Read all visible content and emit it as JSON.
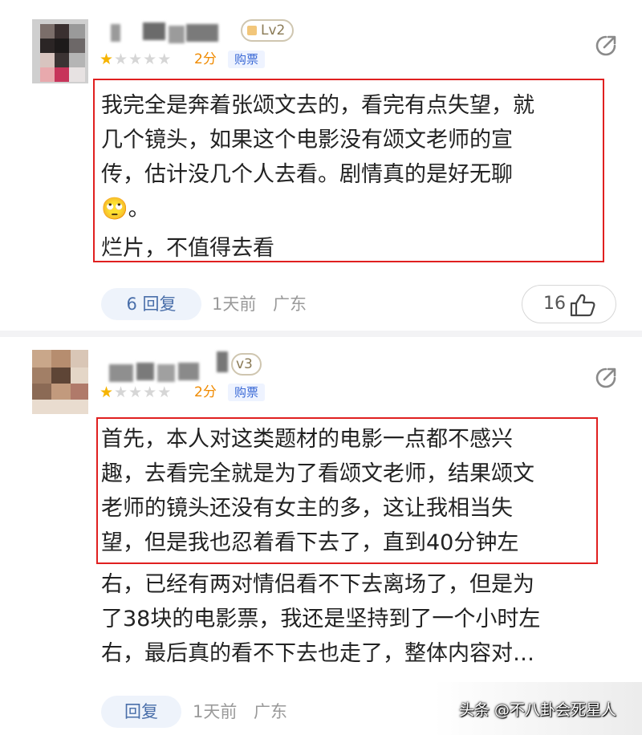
{
  "comments": [
    {
      "level": "Lv2",
      "rating": 1,
      "score": "2分",
      "ticket_tag": "购票",
      "text_lines": [
        "我完全是奔着张颂文去的，看完有点失望，就",
        "几个镜头，如果这个电影没有颂文老师的宣",
        "传，估计没几个人去看。剧情真的是好无聊",
        "🙄。",
        "烂片，不值得去看"
      ],
      "reply_label": "6 回复",
      "time": "1天前",
      "location": "广东",
      "likes": "16"
    },
    {
      "level": "v3",
      "rating": 1,
      "score": "2分",
      "ticket_tag": "购票",
      "text_lines": [
        "首先，本人对这类题材的电影一点都不感兴",
        "趣，去看完全就是为了看颂文老师，结果颂文",
        "老师的镜头还没有女主的多，这让我相当失",
        "望，但是我也忍着看下去了，直到40分钟左",
        "右，已经有两对情侣看不下去离场了，但是为",
        "了38块的电影票，我还是坚持到了一个小时左",
        "右，最后真的看不下去也走了，整体内容对…"
      ],
      "reply_label": "回复",
      "time": "1天前",
      "location": "广东"
    }
  ],
  "watermark": "头条 @不八卦会死星人",
  "colors": {
    "highlight_box": "#e02020",
    "star_filled": "#f6b400",
    "score": "#f08a00",
    "ticket_tag": "#3b6ad6"
  }
}
